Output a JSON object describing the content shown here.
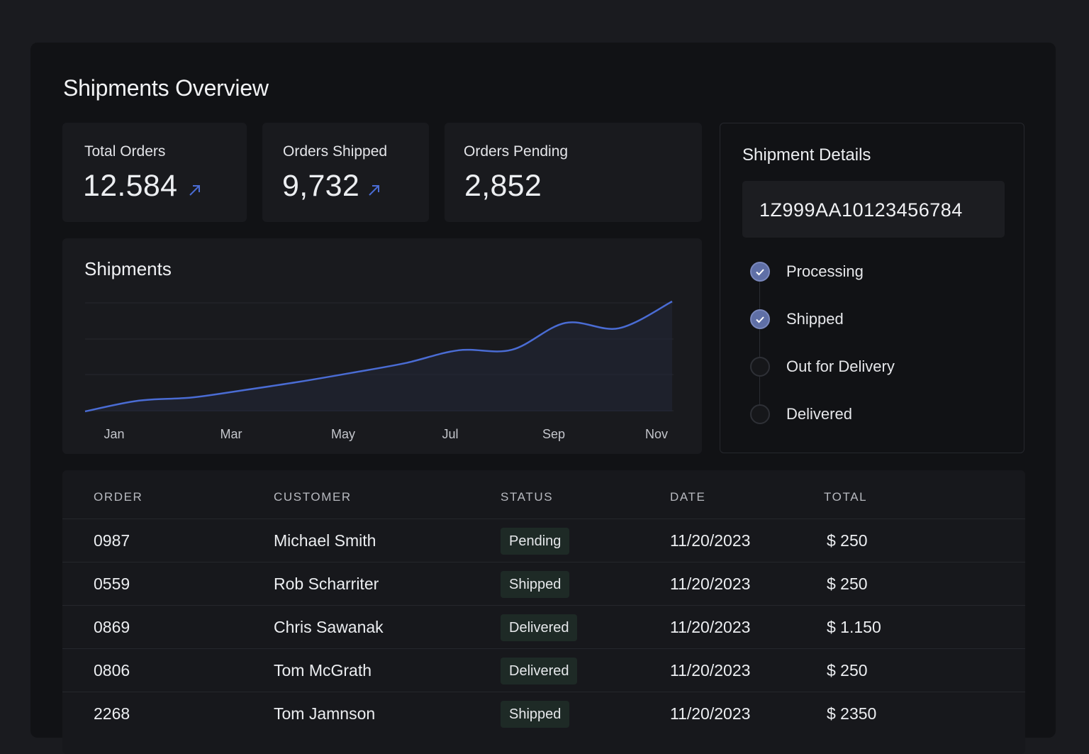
{
  "page": {
    "title": "Shipments Overview"
  },
  "stats": [
    {
      "label": "Total Orders",
      "value": "12.584",
      "trend_icon": "arrow-up-right-icon"
    },
    {
      "label": "Orders Shipped",
      "value": "9,732",
      "trend_icon": "arrow-up-right-icon"
    },
    {
      "label": "Orders Pending",
      "value": "2,852"
    }
  ],
  "colors": {
    "accent": "#4a6cd4",
    "step_done": "#5f6fa6",
    "badge_bg": "#1e2a26",
    "panel_bg": "#111215"
  },
  "chart_data": {
    "type": "area",
    "title": "Shipments",
    "x_tick_labels": [
      "Jan",
      "Mar",
      "May",
      "Jul",
      "Sep",
      "Nov"
    ],
    "x": [
      "Jan",
      "",
      "Mar",
      "",
      "May",
      "",
      "Jul",
      "",
      "Sep",
      "",
      "Nov",
      ""
    ],
    "values": [
      0,
      20,
      26,
      40,
      55,
      72,
      90,
      114,
      115,
      165,
      155,
      205
    ],
    "grid": true,
    "legend": "none"
  },
  "details": {
    "title": "Shipment Details",
    "tracking_number": "1Z999AA10123456784",
    "steps": [
      {
        "label": "Processing",
        "done": true
      },
      {
        "label": "Shipped",
        "done": true
      },
      {
        "label": "Out for Delivery",
        "done": false
      },
      {
        "label": "Delivered",
        "done": false
      }
    ]
  },
  "table": {
    "headers": [
      "ORDER",
      "CUSTOMER",
      "STATUS",
      "DATE",
      "TOTAL"
    ],
    "rows": [
      {
        "order": "0987",
        "customer": "Michael Smith",
        "status": "Pending",
        "date": "11/20/2023",
        "total": "$ 250"
      },
      {
        "order": "0559",
        "customer": "Rob Scharriter",
        "status": "Shipped",
        "date": "11/20/2023",
        "total": "$ 250"
      },
      {
        "order": "0869",
        "customer": "Chris Sawanak",
        "status": "Delivered",
        "date": "11/20/2023",
        "total": "$ 1.150"
      },
      {
        "order": "0806",
        "customer": "Tom McGrath",
        "status": "Delivered",
        "date": "11/20/2023",
        "total": "$ 250"
      },
      {
        "order": "2268",
        "customer": "Tom Jamnson",
        "status": "Shipped",
        "date": "11/20/2023",
        "total": "$ 2350"
      }
    ]
  }
}
